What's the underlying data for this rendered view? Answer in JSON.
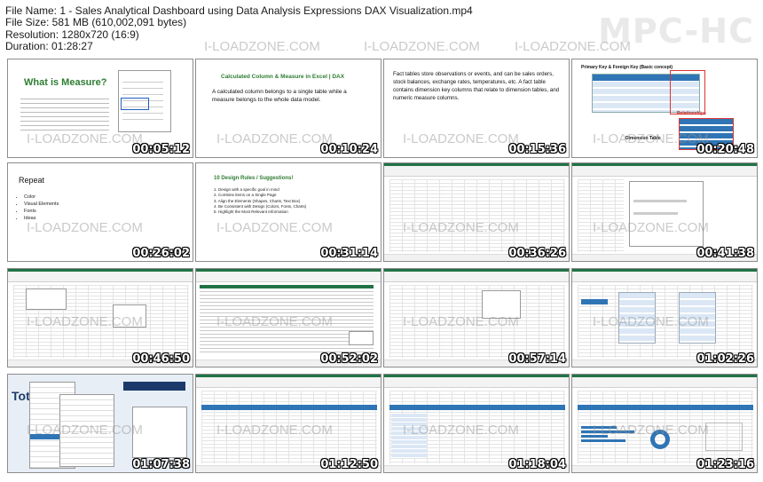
{
  "file_info": {
    "name": "File Name: 1 - Sales Analytical Dashboard using Data Analysis Expressions DAX Visualization.mp4",
    "size": "File Size: 581 MB (610,002,091 bytes)",
    "resolution": "Resolution: 1280x720 (16:9)",
    "duration": "Duration: 01:28:27"
  },
  "brand": "MPC-HC",
  "watermark": "I-LOADZONE.COM",
  "thumbnails": [
    {
      "time": "00:05:12",
      "title": "What is Measure?"
    },
    {
      "time": "00:10:24",
      "title": "Calculated Column & Measure in Excel | DAX",
      "body": "A calculated column belongs to a single table while a measure belongs to the whole data model."
    },
    {
      "time": "00:15:36",
      "body": "Fact tables store observations or events, and can be sales orders, stock balances, exchange rates, temperatures, etc. A fact table contains dimension key columns that relate to dimension tables, and numeric measure columns."
    },
    {
      "time": "00:20:48",
      "title": "Primary Key & Foreign Key (Basic concept)",
      "label1": "Dimension Table",
      "label2": "Relationships"
    },
    {
      "time": "00:26:02",
      "title": "Repeat",
      "bullets": [
        "Color",
        "Visual Elements",
        "Fonts",
        "Ideas"
      ]
    },
    {
      "time": "00:31:14",
      "title": "10 Design Rules / Suggestions!",
      "rules": [
        "1.  Design with a specific goal in mind",
        "2.  Combine items on a Single Page",
        "3.  Align the Elements (Shapes, Charts, Text Box)",
        "4.  Be Consistent with Design (Colors, Fonts, Charts)",
        "5.  Highlight the Most Relevant Information"
      ]
    },
    {
      "time": "00:36:26"
    },
    {
      "time": "00:41:38"
    },
    {
      "time": "00:46:50"
    },
    {
      "time": "00:52:02"
    },
    {
      "time": "00:57:14"
    },
    {
      "time": "01:02:26"
    },
    {
      "time": "01:07:38",
      "title": "Tot"
    },
    {
      "time": "01:12:50"
    },
    {
      "time": "01:18:04"
    },
    {
      "time": "01:23:16"
    }
  ]
}
